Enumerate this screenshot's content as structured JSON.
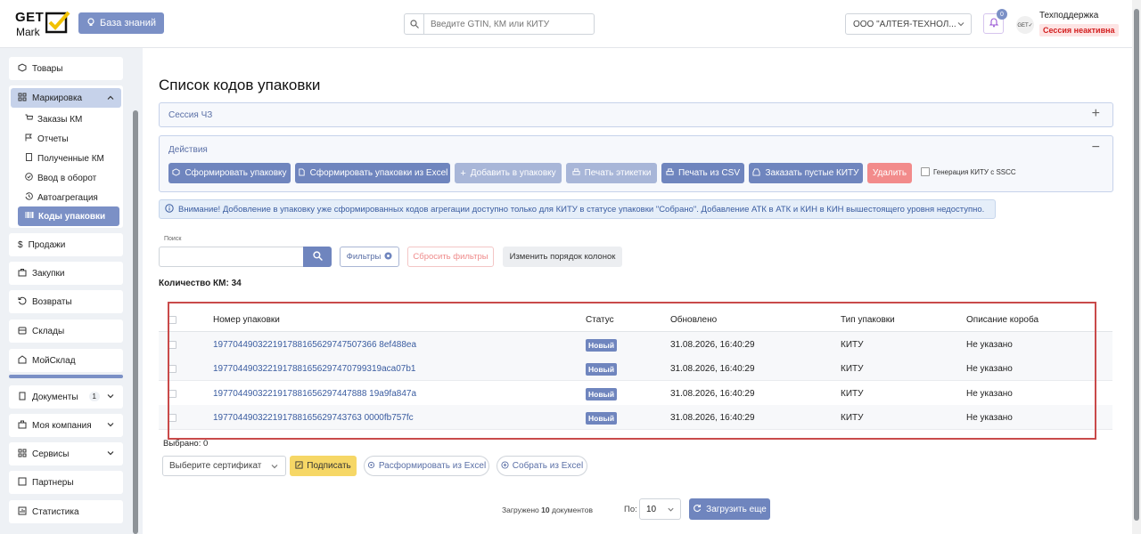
{
  "header": {
    "logo_get": "GET",
    "logo_mark": "Mark",
    "knowledge_base": "База знаний",
    "search_placeholder": "Введите GTIN, КМ или КИТУ",
    "organization": "ООО \"АЛТЕЯ-ТЕХНОЛ...",
    "notif_count": "0",
    "avatar_text": "GET✓",
    "user_name": "Техподдержка",
    "session_status": "Сессия неактивна"
  },
  "sidebar": {
    "goods": "Товары",
    "marking": "Маркировка",
    "marking_sub": [
      "Заказы КМ",
      "Отчеты",
      "Полученные КМ",
      "Ввод в оборот",
      "Автоагрегация",
      "Коды упаковки"
    ],
    "sales": "Продажи",
    "purchases": "Закупки",
    "returns": "Возвраты",
    "warehouses": "Склады",
    "moysklad": "МойСклад",
    "documents": "Документы",
    "documents_count": "1",
    "company": "Моя компания",
    "services": "Сервисы",
    "partners": "Партнеры",
    "statistics": "Статистика"
  },
  "main": {
    "title": "Список кодов упаковки",
    "session_panel": "Сессия ЧЗ",
    "actions_panel": "Действия",
    "actions": {
      "form_pack": "Сформировать упаковку",
      "form_excel": "Сформировать упаковки из Excel",
      "add_pack": "Добавить в упаковку",
      "print_labels": "Печать этикетки",
      "print_csv": "Печать из CSV",
      "order_kitu": "Заказать пустые КИТУ",
      "delete": "Удалить",
      "gen_kitu": "Генерация КИТУ с SSCC"
    },
    "notice": "Внимание! Добовление в упаковку уже сформированных кодов агрегации доступно только для КИТУ в статусе упаковки \"Собрано\". Добавление АТК в АТК и КИН в КИН вышестоящего уровня недоступно.",
    "search_label": "Поиск",
    "filters": "Фильтры",
    "reset_filters": "Сбросить фильтры",
    "column_order": "Изменить порядок колонок",
    "count_km": "Количество КМ: 34",
    "selected": "Выбрано: 0",
    "cert_placeholder": "Выберите сертификат",
    "sign": "Подписать",
    "unform_excel": "Расформировать из Excel",
    "collect_excel": "Собрать из Excel",
    "loaded_prefix": "Загружено",
    "loaded_count": "10",
    "loaded_suffix": "документов",
    "per_label": "По:",
    "per_value": "10",
    "load_more": "Загрузить еще"
  },
  "table": {
    "headers": [
      "Номер упаковки",
      "Статус",
      "Обновлено",
      "Тип упаковки",
      "Описание короба"
    ],
    "rows": [
      [
        "197704490322191788165629747507366 8ef488ea",
        "Новый",
        "31.08.2026, 16:40:29",
        "КИТУ",
        "Не указано"
      ],
      [
        "1977044903221917881656297470799319aca07b1",
        "Новый",
        "31.08.2026, 16:40:29",
        "КИТУ",
        "Не указано"
      ],
      [
        "1977044903221917881656297447888 19a9fa847a",
        "Новый",
        "31.08.2026, 16:40:29",
        "КИТУ",
        "Не указано"
      ],
      [
        "197704490322191788165629743763 0000fb757fc",
        "Новый",
        "31.08.2026, 16:40:29",
        "КИТУ",
        "Не указано"
      ]
    ]
  }
}
